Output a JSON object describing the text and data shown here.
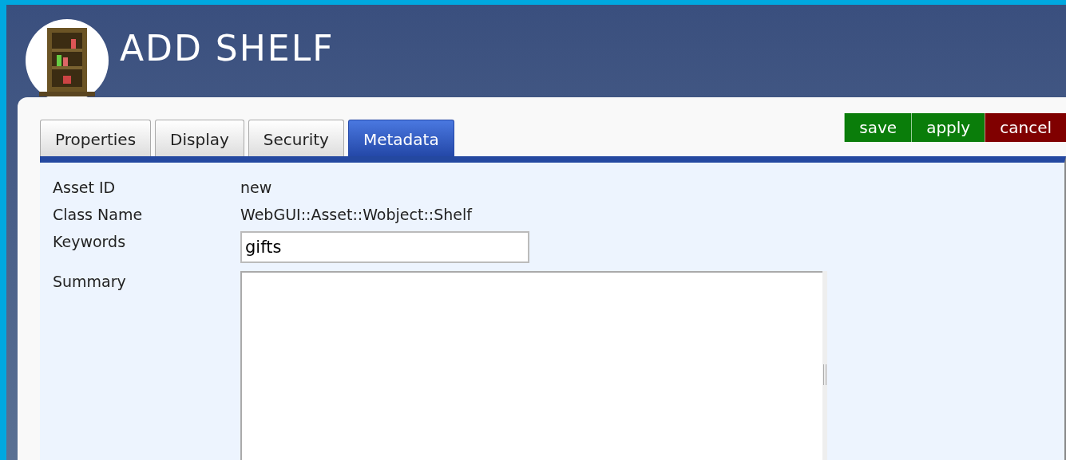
{
  "header": {
    "title": "ADD SHELF"
  },
  "tabs": [
    {
      "label": "Properties",
      "selected": false
    },
    {
      "label": "Display",
      "selected": false
    },
    {
      "label": "Security",
      "selected": false
    },
    {
      "label": "Metadata",
      "selected": true
    }
  ],
  "buttons": [
    {
      "label": "save",
      "kind": "confirm"
    },
    {
      "label": "apply",
      "kind": "confirm"
    },
    {
      "label": "cancel",
      "kind": "cancel"
    }
  ],
  "fields": [
    {
      "label": "Asset ID",
      "kind": "text",
      "value": "new"
    },
    {
      "label": "Class Name",
      "kind": "text",
      "value": "WebGUI::Asset::Wobject::Shelf"
    },
    {
      "label": "Keywords",
      "kind": "input",
      "value": "gifts"
    },
    {
      "label": "Summary",
      "kind": "textarea"
    }
  ]
}
